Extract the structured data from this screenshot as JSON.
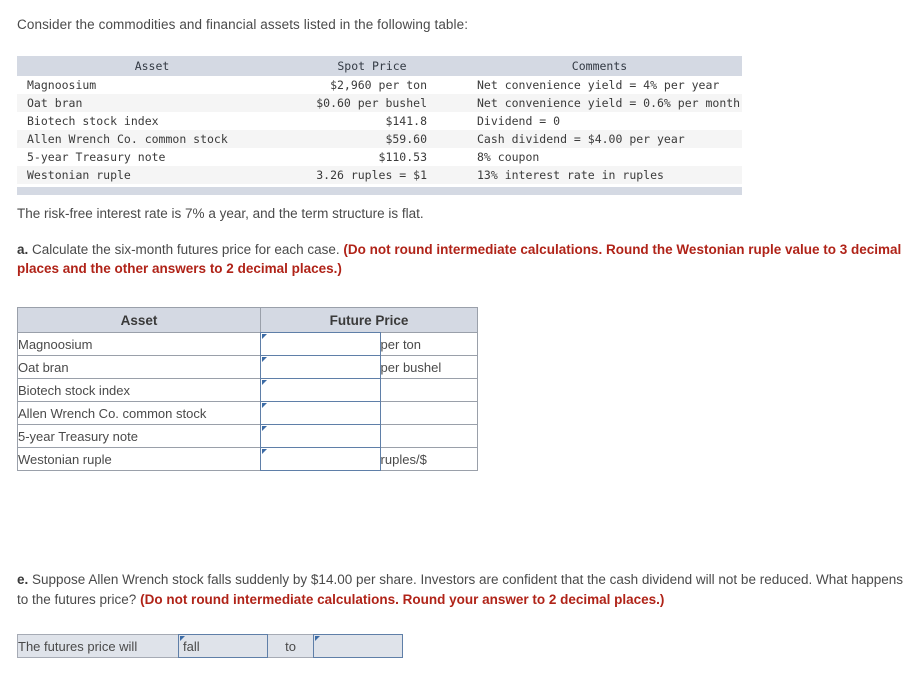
{
  "intro": {
    "text": "Consider the commodities and financial assets listed in the following table:"
  },
  "spot_table": {
    "headers": [
      "Asset",
      "Spot Price",
      "Comments"
    ],
    "rows": [
      {
        "asset": "Magnoosium",
        "spot_price": "$2,960 per ton",
        "comments": "Net convenience yield = 4% per year"
      },
      {
        "asset": "Oat bran",
        "spot_price": "$0.60 per bushel",
        "comments": "Net convenience yield = 0.6% per month"
      },
      {
        "asset": "Biotech stock index",
        "spot_price": "$141.8",
        "comments": "Dividend = 0"
      },
      {
        "asset": "Allen Wrench Co. common stock",
        "spot_price": "$59.60",
        "comments": "Cash dividend = $4.00 per year"
      },
      {
        "asset": "5-year Treasury note",
        "spot_price": "$110.53",
        "comments": "8% coupon"
      },
      {
        "asset": "Westonian ruple",
        "spot_price": "3.26 ruples = $1",
        "comments": "13% interest rate in ruples"
      }
    ]
  },
  "riskfree": {
    "text": "The risk-free interest rate is 7% a year, and the term structure is flat."
  },
  "question_a": {
    "label": "a.",
    "body": " Calculate the six-month futures price for each case. ",
    "red": "(Do not round intermediate calculations. Round the Westonian ruple value to 3 decimal places and the other answers to 2 decimal places.)"
  },
  "answer_table": {
    "headers": [
      "Asset",
      "Future Price"
    ],
    "rows": [
      {
        "asset": "Magnoosium",
        "value": "",
        "unit": "per ton"
      },
      {
        "asset": "Oat bran",
        "value": "",
        "unit": "per bushel"
      },
      {
        "asset": "Biotech stock index",
        "value": "",
        "unit": ""
      },
      {
        "asset": "Allen Wrench Co. common stock",
        "value": "",
        "unit": ""
      },
      {
        "asset": "5-year Treasury note",
        "value": "",
        "unit": ""
      },
      {
        "asset": "Westonian ruple",
        "value": "",
        "unit": "ruples/$"
      }
    ]
  },
  "question_e": {
    "label": "e.",
    "body": " Suppose Allen Wrench stock falls suddenly by $14.00 per share. Investors are confident that the cash dividend will not be reduced. What happens to the futures price? ",
    "red": "(Do not round intermediate calculations. Round your answer to 2 decimal places.)"
  },
  "bottom_answer": {
    "label": "The futures price will",
    "direction": "fall",
    "connector": "to",
    "amount": ""
  },
  "colors": {
    "header_fill": "#d4d9e3",
    "stripe_fill": "#f5f5f5",
    "input_border": "#5f7fa8",
    "input_marker": "#3c6ba5",
    "red_text": "#b02318",
    "body_text": "#4a4a4a",
    "bottom_row_fill": "#dfe3ea"
  }
}
